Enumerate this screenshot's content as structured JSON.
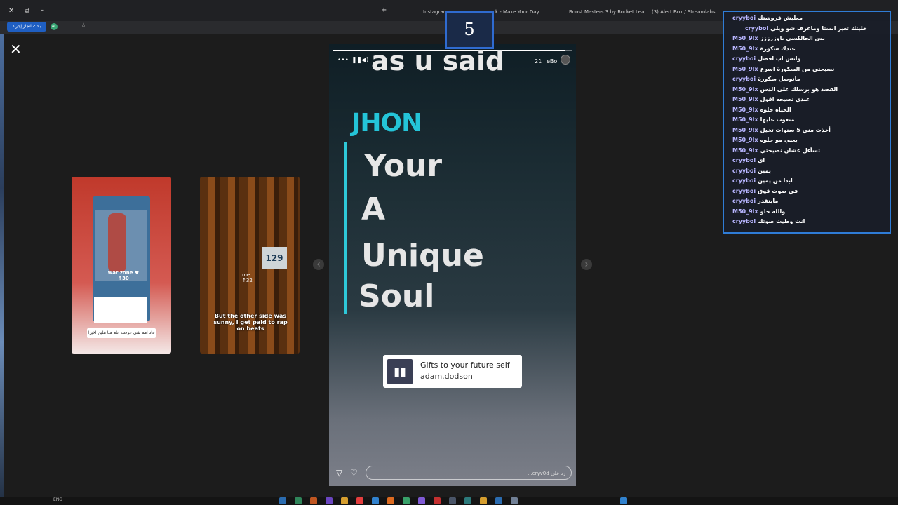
{
  "browser": {
    "tabs": [
      {
        "label": "Instagram"
      },
      {
        "label": "k - Make Your Day"
      },
      {
        "label": "Boost Masters 3 by Rocket Lea"
      },
      {
        "label": "(3) Alert Box / Streamlabs"
      }
    ],
    "action_button": "بحث انجاز إجراء",
    "account_initials": "AL"
  },
  "timer": {
    "value": "5"
  },
  "left_card": {
    "overlay_text": "war zone ",
    "overlay_number": "30",
    "caption": "عاد اهم شي عرفت اتام منا هلين اخيرا"
  },
  "right_card": {
    "price": "129",
    "me_label": "me",
    "me_number": "32",
    "caption": "But the other side was sunny, I get paid to rap on beats"
  },
  "story": {
    "username": "eBoi",
    "time": "21",
    "progress": 0.97,
    "top_text": "as u said",
    "name_text": "JHON",
    "lines": [
      "Your",
      "A",
      "Unique",
      "Soul"
    ],
    "music_title": "Gifts to your future self",
    "music_artist": "adam.dodson",
    "reply_placeholder": "رد على cryv0d..."
  },
  "chat": {
    "messages": [
      {
        "user": "cryyboi",
        "text": "معليش قروشتك",
        "color": "#b8b6ff"
      },
      {
        "user": "cryyboi",
        "text": "خليتك تغير انستا وماعرف شو ويلي",
        "color": "#b8b6ff"
      },
      {
        "user": "M50_9lx",
        "text": "بس الجالكسي باوززززز",
        "color": "#b8b6ff"
      },
      {
        "user": "M50_9lx",
        "text": "عندك سكورة",
        "color": "#b8b6ff"
      },
      {
        "user": "cryyboi",
        "text": "واتس اب افضل",
        "color": "#b8b6ff"
      },
      {
        "user": "M50_9lx",
        "text": "نصيحتي من السكورة اسرع",
        "color": "#b8b6ff"
      },
      {
        "user": "cryyboi",
        "text": "مانوصل سكورة",
        "color": "#b8b6ff"
      },
      {
        "user": "M50_9lx",
        "text": "القصد هو برسلك على الدس",
        "color": "#b8b6ff"
      },
      {
        "user": "M50_9lx",
        "text": "عندي نصيحه اقول",
        "color": "#b8b6ff"
      },
      {
        "user": "M50_9lx",
        "text": "الحياه حلوه",
        "color": "#b8b6ff"
      },
      {
        "user": "M50_9lx",
        "text": "متعوب عليها",
        "color": "#b8b6ff"
      },
      {
        "user": "M50_9lx",
        "text": "أخذت مني 5 سنوات تخيل",
        "color": "#b8b6ff"
      },
      {
        "user": "M50_9lx",
        "text": "يعني مو حلوه",
        "color": "#b8b6ff"
      },
      {
        "user": "M50_9lx",
        "text": "تسأءل عشان نصيحتي",
        "color": "#b8b6ff"
      },
      {
        "user": "cryyboi",
        "text": "اي",
        "color": "#b8b6ff"
      },
      {
        "user": "cryyboi",
        "text": "يمين",
        "color": "#b8b6ff"
      },
      {
        "user": "cryyboi",
        "text": "ابدا من يمين",
        "color": "#b8b6ff"
      },
      {
        "user": "cryyboi",
        "text": "في صوت قوق",
        "color": "#b8b6ff"
      },
      {
        "user": "cryyboi",
        "text": "مايتقدر",
        "color": "#b8b6ff"
      },
      {
        "user": "M50_9lx",
        "text": "والله حلو",
        "color": "#b8b6ff"
      },
      {
        "user": "cryyboi",
        "text": "انت وطيت صوتك",
        "color": "#b8b6ff"
      }
    ]
  },
  "taskbar": {
    "language": "ENG"
  }
}
